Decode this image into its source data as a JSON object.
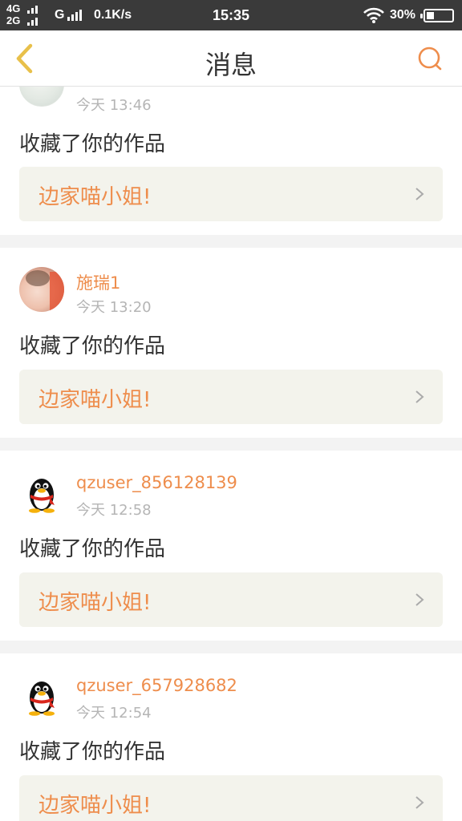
{
  "status_bar": {
    "net_top": "4G",
    "net_bottom": "2G",
    "net_g": "G",
    "speed": "0.1K/s",
    "time": "15:35",
    "battery": "30%",
    "battery_level": 0.3
  },
  "header": {
    "title": "消息",
    "back_icon": "chevron-left-icon",
    "search_icon": "search-icon"
  },
  "colors": {
    "accent": "#ee8d4c",
    "link_bg": "#f3f3ec",
    "separator": "#f3f3f3"
  },
  "messages": [
    {
      "username": "",
      "time": "今天 13:46",
      "action": "收藏了你的作品",
      "work": "边家喵小姐!",
      "avatar": "photo-avatar"
    },
    {
      "username": "施瑞1",
      "time": "今天 13:20",
      "action": "收藏了你的作品",
      "work": "边家喵小姐!",
      "avatar": "photo-avatar"
    },
    {
      "username": "qzuser_856128139",
      "time": "今天 12:58",
      "action": "收藏了你的作品",
      "work": "边家喵小姐!",
      "avatar": "qq-penguin-icon"
    },
    {
      "username": "qzuser_657928682",
      "time": "今天 12:54",
      "action": "收藏了你的作品",
      "work": "边家喵小姐!",
      "avatar": "qq-penguin-icon"
    }
  ]
}
